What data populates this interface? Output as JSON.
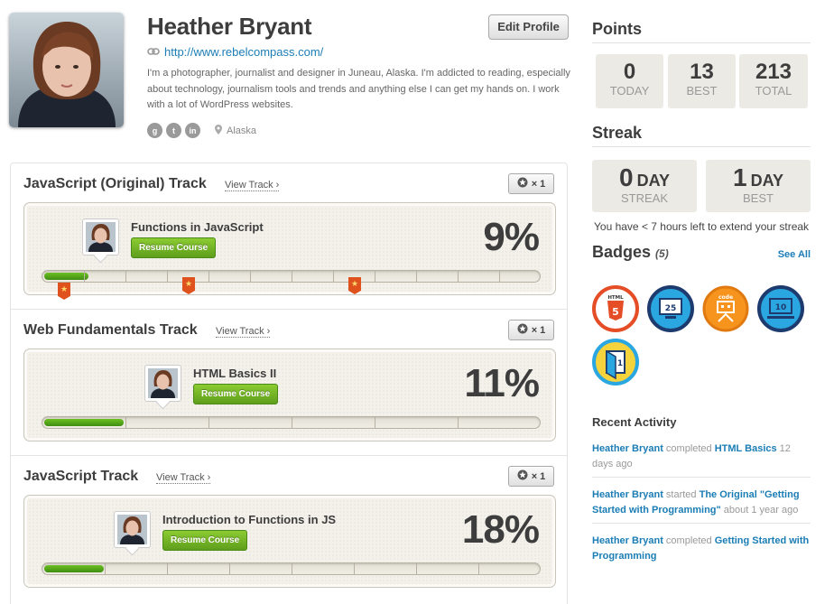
{
  "profile": {
    "name": "Heather Bryant",
    "edit_label": "Edit Profile",
    "url": "http://www.rebelcompass.com/",
    "bio": "I'm a photographer, journalist and designer in Juneau, Alaska. I'm addicted to reading, especially about technology, journalism tools and trends and anything else I can get my hands on. I work with a lot of WordPress websites.",
    "social_icons": [
      "g",
      "t",
      "in"
    ],
    "location": "Alaska"
  },
  "tracks": [
    {
      "title": "JavaScript (Original) Track",
      "view_label": "View Track ›",
      "star_count": "× 1",
      "course": "Functions in JavaScript",
      "resume_label": "Resume Course",
      "percent": "9%",
      "progress": 0.09
    },
    {
      "title": "Web Fundamentals Track",
      "view_label": "View Track ›",
      "star_count": "× 1",
      "course": "HTML Basics II",
      "resume_label": "Resume Course",
      "percent": "11%",
      "progress": 0.16
    },
    {
      "title": "JavaScript Track",
      "view_label": "View Track ›",
      "star_count": "× 1",
      "course": "Introduction to Functions in JS",
      "resume_label": "Resume Course",
      "percent": "18%",
      "progress": 0.12
    }
  ],
  "points": {
    "heading": "Points",
    "today": {
      "value": "0",
      "label": "TODAY"
    },
    "best": {
      "value": "13",
      "label": "BEST"
    },
    "total": {
      "value": "213",
      "label": "TOTAL"
    }
  },
  "streak": {
    "heading": "Streak",
    "current": {
      "value": "0",
      "unit": "DAY",
      "label": "STREAK"
    },
    "best": {
      "value": "1",
      "unit": "DAY",
      "label": "BEST"
    },
    "note": "You have < 7 hours left to extend your streak"
  },
  "badges": {
    "heading": "Badges",
    "count": "(5)",
    "see_all": "See All",
    "colors": {
      "html5": "#e44d26",
      "blue": "#2aa7e0",
      "orange": "#f7941d",
      "yellow": "#f5d33c"
    }
  },
  "recent": {
    "heading": "Recent Activity",
    "items": [
      {
        "user": "Heather Bryant",
        "verb": " completed ",
        "target": "HTML Basics",
        "time": " 12 days ago"
      },
      {
        "user": "Heather Bryant",
        "verb": " started ",
        "target": "The Original \"Getting Started with Programming\"",
        "time": " about 1 year ago"
      },
      {
        "user": "Heather Bryant",
        "verb": " completed ",
        "target": "Getting Started with Programming",
        "time": ""
      }
    ]
  },
  "colors": {
    "link": "#1b7db5",
    "progress": "#4fa51a",
    "flag": "#e0521d"
  }
}
